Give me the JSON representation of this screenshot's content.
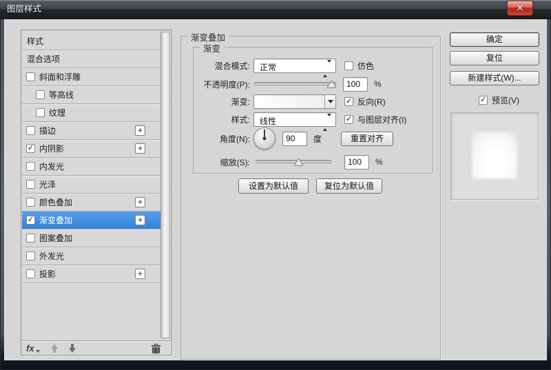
{
  "window": {
    "title": "图层样式"
  },
  "icons": {
    "close": "✕",
    "check": "✓",
    "plus": "+",
    "fx": "fx"
  },
  "colors": {
    "selection_blue": "#3a86dd",
    "close_red": "#b3281c",
    "client_gray": "#d6d6d6"
  },
  "sidebar": {
    "items": [
      {
        "label": "样式",
        "checkbox": false,
        "checked": false,
        "indent": false,
        "plus": false,
        "selected": false
      },
      {
        "label": "混合选项",
        "checkbox": false,
        "checked": false,
        "indent": false,
        "plus": false,
        "selected": false
      },
      {
        "label": "斜面和浮雕",
        "checkbox": true,
        "checked": false,
        "indent": false,
        "plus": false,
        "selected": false
      },
      {
        "label": "等高线",
        "checkbox": true,
        "checked": false,
        "indent": true,
        "plus": false,
        "selected": false
      },
      {
        "label": "纹理",
        "checkbox": true,
        "checked": false,
        "indent": true,
        "plus": false,
        "selected": false
      },
      {
        "label": "描边",
        "checkbox": true,
        "checked": false,
        "indent": false,
        "plus": true,
        "selected": false
      },
      {
        "label": "内阴影",
        "checkbox": true,
        "checked": true,
        "indent": false,
        "plus": true,
        "selected": false
      },
      {
        "label": "内发光",
        "checkbox": true,
        "checked": false,
        "indent": false,
        "plus": false,
        "selected": false
      },
      {
        "label": "光泽",
        "checkbox": true,
        "checked": false,
        "indent": false,
        "plus": false,
        "selected": false
      },
      {
        "label": "颜色叠加",
        "checkbox": true,
        "checked": false,
        "indent": false,
        "plus": true,
        "selected": false
      },
      {
        "label": "渐变叠加",
        "checkbox": true,
        "checked": true,
        "indent": false,
        "plus": true,
        "selected": true
      },
      {
        "label": "图案叠加",
        "checkbox": true,
        "checked": false,
        "indent": false,
        "plus": false,
        "selected": false
      },
      {
        "label": "外发光",
        "checkbox": true,
        "checked": false,
        "indent": false,
        "plus": false,
        "selected": false
      },
      {
        "label": "投影",
        "checkbox": true,
        "checked": false,
        "indent": false,
        "plus": true,
        "selected": false
      }
    ]
  },
  "panel": {
    "title": "渐变叠加",
    "group_title": "渐变",
    "blend_mode": {
      "label": "混合模式:",
      "value": "正常",
      "dither_label": "仿色",
      "dither_checked": false
    },
    "opacity": {
      "label": "不透明度(P):",
      "value": "100",
      "unit": "%"
    },
    "gradient": {
      "label": "渐变:",
      "reverse_label": "反向(R)",
      "reverse_checked": true
    },
    "style": {
      "label": "样式:",
      "value": "线性",
      "align_label": "与图层对齐(I)",
      "align_checked": true
    },
    "angle": {
      "label": "角度(N):",
      "value": "90",
      "unit": "度",
      "reset_button": "重置对齐"
    },
    "scale": {
      "label": "缩放(S):",
      "value": "100",
      "unit": "%"
    },
    "set_default_button": "设置为默认值",
    "reset_default_button": "复位为默认值"
  },
  "actions": {
    "ok": "确定",
    "reset": "复位",
    "new_style": "新建样式(W)...",
    "preview_label": "预览(V)",
    "preview_checked": true
  }
}
